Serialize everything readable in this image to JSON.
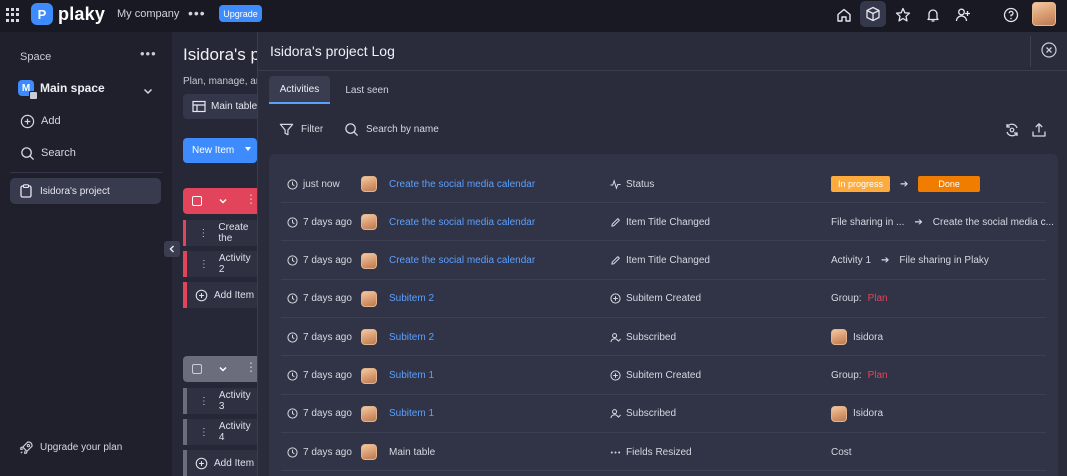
{
  "topbar": {
    "logo_text": "plaky",
    "company": "My company",
    "more": "•••",
    "upgrade": "Upgrade",
    "icons": [
      "home-icon",
      "box-icon",
      "star-icon",
      "bell-icon",
      "add-user-icon",
      "help-icon"
    ]
  },
  "sidebar": {
    "space_label": "Space",
    "more": "•••",
    "space_initial": "M",
    "space_name": "Main space",
    "add": "Add",
    "search": "Search",
    "project": "Isidora's project",
    "upgrade_plan": "Upgrade your plan"
  },
  "main": {
    "title": "Isidora's pr",
    "subtitle": "Plan, manage, anc",
    "table_tab": "Main table",
    "new_item": "New Item",
    "group1_rows": [
      "Create the",
      "Activity 2"
    ],
    "group2_rows": [
      "Activity 3",
      "Activity 4"
    ],
    "add_item": "Add Item",
    "colors": {
      "group1": "#e2445c",
      "group2": "#6b6d7c"
    }
  },
  "panel": {
    "title": "Isidora's project Log",
    "tabs": [
      "Activities",
      "Last seen"
    ],
    "filter": "Filter",
    "search_placeholder": "Search by name",
    "rows": [
      {
        "time": "just now",
        "item": "Create the social media calendar",
        "item_link": true,
        "action_icon": "activity-icon",
        "action": "Status",
        "from": "In progress",
        "to": "Done"
      },
      {
        "time": "7 days ago",
        "item": "Create the social media calendar",
        "item_link": true,
        "action_icon": "pencil-icon",
        "action": "Item Title Changed",
        "from": "File sharing in ...",
        "to": "Create the social media c..."
      },
      {
        "time": "7 days ago",
        "item": "Create the social media calendar",
        "item_link": true,
        "action_icon": "pencil-icon",
        "action": "Item Title Changed",
        "from": "Activity 1",
        "to": "File sharing in Plaky"
      },
      {
        "time": "7 days ago",
        "item": "Subitem 2",
        "item_link": true,
        "action_icon": "plus-circle-icon",
        "action": "Subitem Created",
        "label": "Group:",
        "value": "Plan"
      },
      {
        "time": "7 days ago",
        "item": "Subitem 2",
        "item_link": true,
        "action_icon": "subscribe-icon",
        "action": "Subscribed",
        "user": "Isidora"
      },
      {
        "time": "7 days ago",
        "item": "Subitem 1",
        "item_link": true,
        "action_icon": "plus-circle-icon",
        "action": "Subitem Created",
        "label": "Group:",
        "value": "Plan"
      },
      {
        "time": "7 days ago",
        "item": "Subitem 1",
        "item_link": true,
        "action_icon": "subscribe-icon",
        "action": "Subscribed",
        "user": "Isidora"
      },
      {
        "time": "7 days ago",
        "item": "Main table",
        "item_link": false,
        "action_icon": "dots-icon",
        "action": "Fields Resized",
        "text": "Cost"
      }
    ],
    "colors": {
      "in_progress": "#fdab3d",
      "done": "#f07d00",
      "link": "#5aa0ff",
      "group_value": "#e2445c"
    }
  }
}
